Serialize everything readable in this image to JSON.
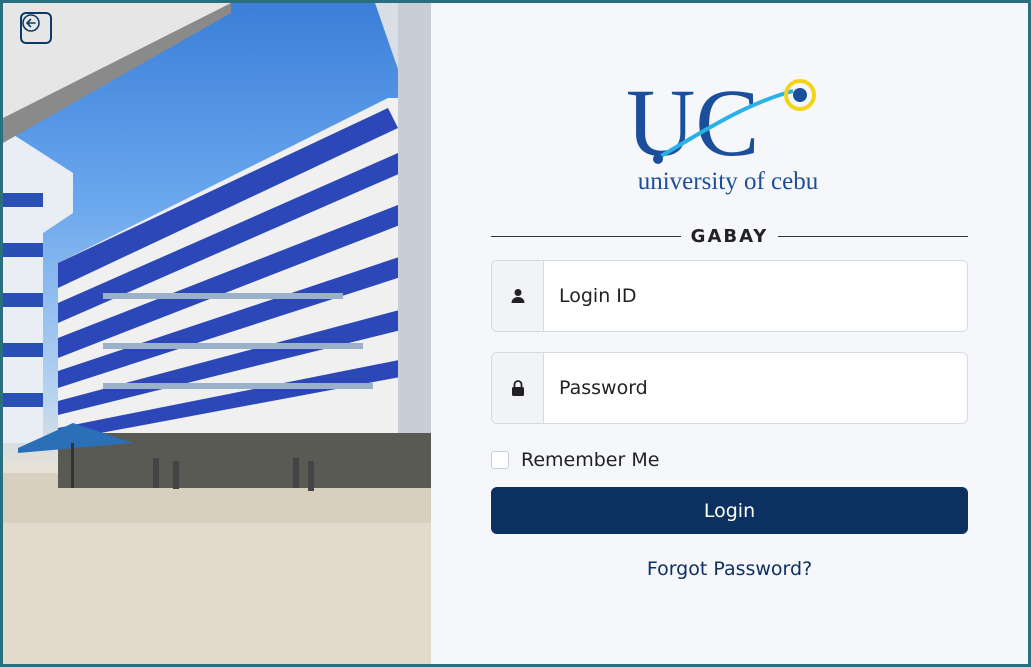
{
  "brand": {
    "name": "GABAY",
    "logo_text": "university of cebu",
    "logo_letters": "UC"
  },
  "login_id": {
    "placeholder": "Login ID"
  },
  "password": {
    "placeholder": "Password"
  },
  "remember": {
    "label": "Remember Me",
    "checked": false
  },
  "actions": {
    "login_label": "Login",
    "forgot_label": "Forgot Password?"
  },
  "colors": {
    "primary": "#0c3060",
    "logo_blue": "#1b4e9b",
    "accent_cyan": "#2ab1e6",
    "accent_yellow": "#f2d51b"
  },
  "icons": {
    "back": "arrow-left-icon",
    "user": "user-icon",
    "lock": "lock-icon"
  }
}
